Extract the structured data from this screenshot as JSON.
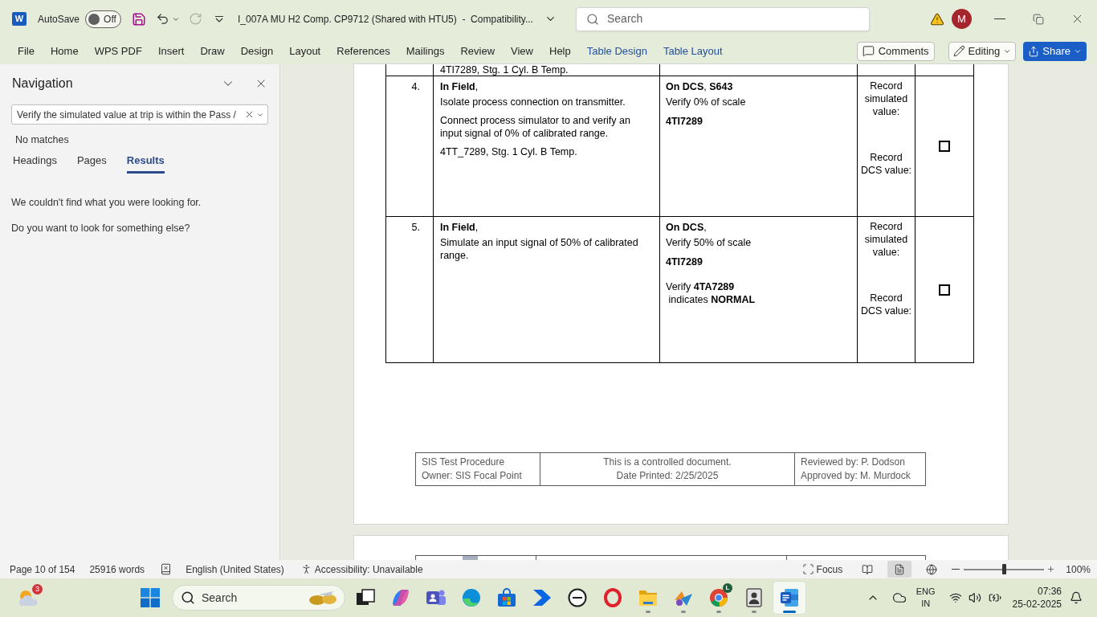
{
  "title_bar": {
    "logo": "W",
    "autosave_label": "AutoSave",
    "autosave": {
      "on": false,
      "label": "Off"
    },
    "redo": {
      "disabled": true
    },
    "document_title": "I_007A MU H2 Comp. CP9712 (Shared with HTU5)  -  Compatibility...",
    "search": {
      "placeholder": "Search"
    },
    "avatar": "M"
  },
  "ribbon": {
    "tabs": [
      {
        "label": "File",
        "kind": "standard"
      },
      {
        "label": "Home",
        "kind": "standard"
      },
      {
        "label": "WPS PDF",
        "kind": "standard"
      },
      {
        "label": "Insert",
        "kind": "standard"
      },
      {
        "label": "Draw",
        "kind": "standard"
      },
      {
        "label": "Design",
        "kind": "standard"
      },
      {
        "label": "Layout",
        "kind": "standard"
      },
      {
        "label": "References",
        "kind": "standard"
      },
      {
        "label": "Mailings",
        "kind": "standard"
      },
      {
        "label": "Review",
        "kind": "standard"
      },
      {
        "label": "View",
        "kind": "standard"
      },
      {
        "label": "Help",
        "kind": "standard"
      },
      {
        "label": "Table Design",
        "kind": "contextual"
      },
      {
        "label": "Table Layout",
        "kind": "contextual"
      }
    ],
    "comments": "Comments",
    "editing": "Editing",
    "share": "Share"
  },
  "navigation": {
    "title": "Navigation",
    "search": {
      "value": "Verify the simulated value at trip is within the Pass /"
    },
    "status": "No matches",
    "tabs": [
      {
        "label": "Headings",
        "selected": false
      },
      {
        "label": "Pages",
        "selected": false
      },
      {
        "label": "Results",
        "selected": true
      }
    ],
    "messages": [
      "We couldn't find what you were looking for.",
      "Do you want to look for something else?"
    ]
  },
  "document": {
    "partial_row": {
      "column_2": "4TI7289, Stg. 1 Cyl. B Temp."
    },
    "rows": [
      {
        "column_1": "4.",
        "column_2": [
          "**In Field**,",
          "Isolate process connection on transmitter.",
          "Connect process simulator to and verify an input signal of 0% of calibrated range.",
          "4TT_7289, Stg. 1 Cyl. B Temp."
        ],
        "column_3": [
          {
            "kind": "text",
            "text": "**On DCS**, **S643**"
          },
          {
            "kind": "text",
            "text": "Verify 0% of scale"
          },
          {
            "kind": "tag",
            "text": "4TI7289"
          }
        ],
        "column_4": [
          "Record simulated value:",
          "Record DCS value:"
        ],
        "column_5": {
          "checked": false
        }
      },
      {
        "column_1": "5.",
        "column_2": [
          "**In Field**,",
          "Simulate an input signal of 50% of calibrated range."
        ],
        "column_3": [
          {
            "kind": "text",
            "text": "**On DCS**,"
          },
          {
            "kind": "text",
            "text": "Verify 50% of scale"
          },
          {
            "kind": "tag",
            "text": "4TI7289"
          },
          {
            "kind": "text",
            "text": "Verify **4TA7289**\n indicates **NORMAL**"
          }
        ],
        "column_4": [
          "Record simulated value:",
          "Record DCS value:"
        ],
        "column_5": {
          "checked": false
        }
      }
    ],
    "footer": {
      "column_1": [
        "SIS Test Procedure",
        "Owner: SIS Focal Point"
      ],
      "column_2": [
        "This is a controlled document.",
        "Date Printed: 2/25/2025"
      ],
      "column_3": [
        "Reviewed by: P. Dodson",
        "Approved by: M. Murdock"
      ]
    }
  },
  "status_bar": {
    "page": "Page 10 of 154",
    "words": "25916 words",
    "language": "English (United States)",
    "accessibility": "Accessibility: Unavailable",
    "focus": "Focus",
    "views": [
      {
        "kind": "read",
        "selected": false
      },
      {
        "kind": "print",
        "selected": true
      },
      {
        "kind": "web",
        "selected": false
      }
    ],
    "zoom": {
      "level": 0.5,
      "reading": "100%"
    }
  },
  "taskbar": {
    "weather_badge": "3",
    "search": {
      "placeholder": "Search"
    },
    "apps": [
      {
        "kind": "taskview",
        "running": false,
        "active": false
      },
      {
        "kind": "copilot",
        "running": false,
        "active": false
      },
      {
        "kind": "teams",
        "running": false,
        "active": false
      },
      {
        "kind": "edge",
        "running": false,
        "active": false
      },
      {
        "kind": "store",
        "running": false,
        "active": false
      },
      {
        "kind": "automate",
        "running": false,
        "active": false
      },
      {
        "kind": "dell",
        "running": false,
        "active": false
      },
      {
        "kind": "opera",
        "running": false,
        "active": false
      },
      {
        "kind": "files",
        "running": true,
        "active": false
      },
      {
        "kind": "app",
        "running": true,
        "active": false
      },
      {
        "kind": "chrome",
        "running": true,
        "active": false,
        "badge": "L"
      },
      {
        "kind": "contacts",
        "running": true,
        "active": false
      },
      {
        "kind": "word",
        "running": true,
        "active": true
      }
    ],
    "input_language": [
      "ENG",
      "IN"
    ],
    "time": "07:36",
    "date": "25-02-2025"
  }
}
